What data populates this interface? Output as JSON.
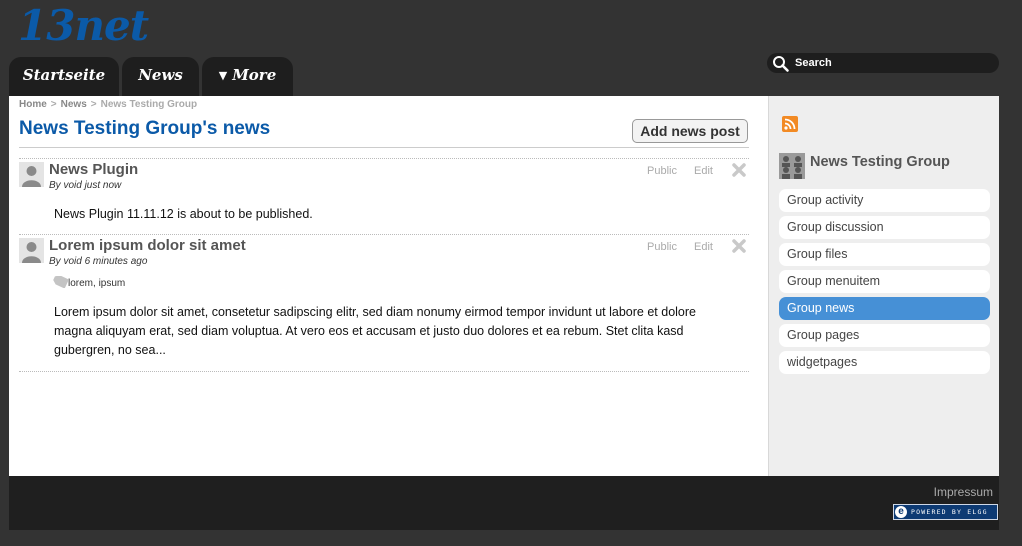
{
  "site": {
    "logo": "13net"
  },
  "nav": {
    "tabs": [
      {
        "label": "Startseite"
      },
      {
        "label": "News"
      },
      {
        "label": "More",
        "arrow": "▼"
      }
    ]
  },
  "search": {
    "placeholder": "Search"
  },
  "breadcrumb": {
    "home": "Home",
    "sep1": ">",
    "news": "News",
    "sep2": ">",
    "current": "News Testing Group"
  },
  "page": {
    "title": "News Testing Group's news",
    "add_button": "Add news post"
  },
  "posts": [
    {
      "title": "News Plugin",
      "byline": "By void just now",
      "access": "Public",
      "edit": "Edit",
      "body": "News Plugin 11.11.12 is about to be published."
    },
    {
      "title": "Lorem ipsum dolor sit amet",
      "byline": "By void 6 minutes ago",
      "access": "Public",
      "edit": "Edit",
      "tags": [
        "lorem",
        "ipsum"
      ],
      "tag_sep": ",",
      "body": "Lorem ipsum dolor sit amet, consetetur sadipscing elitr, sed diam nonumy eirmod tempor invidunt ut labore et dolore magna aliquyam erat, sed diam voluptua. At vero eos et accusam et justo duo dolores et ea rebum. Stet clita kasd gubergren, no sea..."
    }
  ],
  "sidebar": {
    "group_name": "News Testing Group",
    "menu": [
      {
        "label": "Group activity"
      },
      {
        "label": "Group discussion"
      },
      {
        "label": "Group files"
      },
      {
        "label": "Group menuitem"
      },
      {
        "label": "Group news",
        "active": true
      },
      {
        "label": "Group pages"
      },
      {
        "label": "widgetpages"
      }
    ]
  },
  "footer": {
    "impressum": "Impressum",
    "powered": "POWERED BY ELGG"
  },
  "colors": {
    "accent": "#0b5aa8",
    "active_menu": "#4690d6",
    "rss": "#f28a24",
    "background": "#333333"
  }
}
